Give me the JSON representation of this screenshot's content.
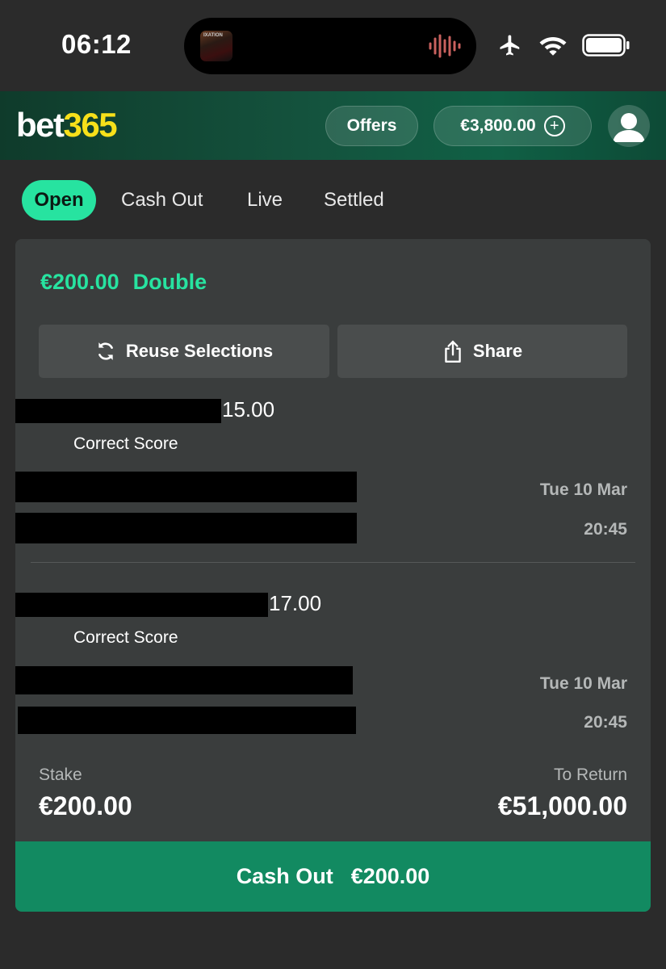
{
  "status_bar": {
    "time": "06:12",
    "island_art_text": "IXATION",
    "icons": [
      "airplane-icon",
      "wifi-icon",
      "battery-icon",
      "sound-wave-icon"
    ]
  },
  "header": {
    "logo_part1": "bet",
    "logo_part2": "365",
    "offers_label": "Offers",
    "balance": "€3,800.00",
    "colors": {
      "brand_green": "#14523d",
      "logo_yellow": "#f7e01a"
    }
  },
  "tabs": [
    {
      "label": "Open",
      "active": true
    },
    {
      "label": "Cash Out",
      "active": false
    },
    {
      "label": "Live",
      "active": false
    },
    {
      "label": "Settled",
      "active": false
    }
  ],
  "bet": {
    "stake_amount": "€200.00",
    "type": "Double",
    "reuse_label": "Reuse Selections",
    "share_label": "Share",
    "selections": [
      {
        "odds": "15.00",
        "market": "Correct Score",
        "date": "Tue 10 Mar",
        "time": "20:45"
      },
      {
        "odds": "17.00",
        "market": "Correct Score",
        "date": "Tue 10 Mar",
        "time": "20:45"
      }
    ],
    "stake_label": "Stake",
    "stake_value": "€200.00",
    "return_label": "To Return",
    "return_value": "€51,000.00",
    "cashout_label": "Cash Out",
    "cashout_value": "€200.00",
    "colors": {
      "accent": "#27e3a0",
      "cashout_bg": "#128a61"
    }
  }
}
